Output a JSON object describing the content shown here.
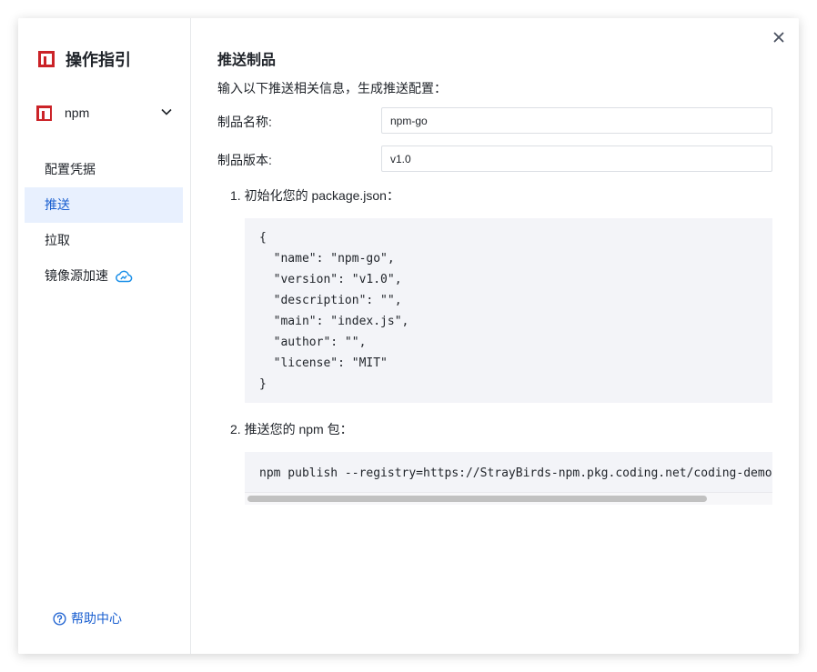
{
  "sidebar": {
    "title": "操作指引",
    "package_type": "npm",
    "menu": [
      {
        "label": "配置凭据",
        "active": false
      },
      {
        "label": "推送",
        "active": true
      },
      {
        "label": "拉取",
        "active": false
      },
      {
        "label": "镜像源加速",
        "active": false,
        "icon": "cloud-icon"
      }
    ],
    "help_label": "帮助中心"
  },
  "main": {
    "title": "推送制品",
    "intro": "输入以下推送相关信息，生成推送配置：",
    "fields": [
      {
        "label": "制品名称:",
        "value": "npm-go"
      },
      {
        "label": "制品版本:",
        "value": "v1.0"
      }
    ],
    "step1": "1. 初始化您的 package.json：",
    "package_json_lines": [
      "{",
      "  \"name\": \"npm-go\",",
      "  \"version\": \"v1.0\",",
      "  \"description\": \"\",",
      "  \"main\": \"index.js\",",
      "  \"author\": \"\",",
      "  \"license\": \"MIT\"",
      "}"
    ],
    "step2": "2. 推送您的 npm 包：",
    "publish_command": "npm publish --registry=https://StrayBirds-npm.pkg.coding.net/coding-demo"
  },
  "colors": {
    "brand_red": "#cb2328",
    "accent_blue": "#1a5fd0",
    "active_bg": "#e8f0fe",
    "code_bg": "#f3f4f8"
  }
}
